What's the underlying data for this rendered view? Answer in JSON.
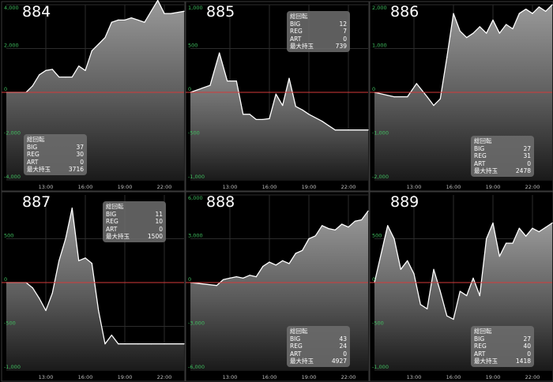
{
  "chart_data": [
    {
      "type": "area",
      "title": "884",
      "ylim": [
        -4000,
        4000
      ],
      "yticks": [
        4000,
        2000,
        0,
        -2000,
        -4000
      ],
      "yticklabels": [
        "4,000",
        "2,000",
        "0",
        "-2,000",
        "-4,000"
      ],
      "xticks": [
        13,
        16,
        19,
        22
      ],
      "xticklabels": [
        "13:00",
        "16:00",
        "19:00",
        "22:00"
      ],
      "xlim": [
        10,
        23.5
      ],
      "x": [
        10,
        11.5,
        12,
        12.5,
        13,
        13.5,
        14,
        14.5,
        15,
        15.5,
        16,
        16.5,
        17,
        17.5,
        18,
        18.5,
        19,
        19.5,
        20,
        20.5,
        21,
        21.5,
        22,
        22.5,
        23.5
      ],
      "y": [
        0,
        0,
        300,
        800,
        1000,
        1050,
        700,
        700,
        700,
        1200,
        1000,
        1900,
        2200,
        2500,
        3200,
        3300,
        3300,
        3400,
        3300,
        3200,
        3700,
        4200,
        3600,
        3600,
        3700
      ],
      "stats": {
        "header": "総回転",
        "rows": [
          [
            "BIG",
            "37"
          ],
          [
            "REG",
            "30"
          ],
          [
            "ART",
            "0"
          ],
          [
            "最大持玉",
            "3716"
          ]
        ]
      },
      "stats_pos": "bottom-left"
    },
    {
      "type": "area",
      "title": "885",
      "ylim": [
        -1000,
        1000
      ],
      "yticks": [
        1000,
        500,
        0,
        -500,
        -1000
      ],
      "yticklabels": [
        "1,000",
        "500",
        "0",
        "-500",
        "-1,000"
      ],
      "xticks": [
        13,
        16,
        19,
        22
      ],
      "xticklabels": [
        "13:00",
        "16:00",
        "19:00",
        "22:00"
      ],
      "xlim": [
        10,
        23.5
      ],
      "x": [
        10,
        11.5,
        12.2,
        12.8,
        13.5,
        14,
        14.5,
        15,
        15.5,
        16,
        16.5,
        17,
        17.5,
        18,
        18.5,
        19,
        20,
        20.5,
        21,
        22,
        23.5
      ],
      "y": [
        0,
        80,
        450,
        130,
        130,
        -250,
        -250,
        -310,
        -310,
        -300,
        -20,
        -150,
        160,
        -160,
        -200,
        -250,
        -330,
        -380,
        -430,
        -430,
        -430
      ],
      "stats": {
        "header": "総回転",
        "rows": [
          [
            "BIG",
            "12"
          ],
          [
            "REG",
            "7"
          ],
          [
            "ART",
            "0"
          ],
          [
            "最大持玉",
            "739"
          ]
        ]
      },
      "stats_pos": "top-right"
    },
    {
      "type": "area",
      "title": "886",
      "ylim": [
        -2000,
        2000
      ],
      "yticks": [
        2000,
        1000,
        0,
        -1000,
        -2000
      ],
      "yticklabels": [
        "2,000",
        "1,000",
        "0",
        "-1,000",
        "-2,000"
      ],
      "xticks": [
        13,
        16,
        19,
        22
      ],
      "xticklabels": [
        "13:00",
        "16:00",
        "19:00",
        "22:00"
      ],
      "xlim": [
        10,
        23.5
      ],
      "x": [
        10,
        11.5,
        12.5,
        13.2,
        14,
        14.5,
        15,
        15.5,
        16,
        16.5,
        17,
        17.5,
        18,
        18.5,
        19,
        19.5,
        20,
        20.5,
        21,
        21.5,
        22,
        22.5,
        23,
        23.5
      ],
      "y": [
        0,
        -100,
        -100,
        200,
        -100,
        -300,
        -150,
        800,
        1800,
        1400,
        1250,
        1350,
        1500,
        1350,
        1650,
        1350,
        1550,
        1450,
        1800,
        1900,
        1800,
        1950,
        1850,
        2000
      ],
      "stats": {
        "header": "総回転",
        "rows": [
          [
            "BIG",
            "27"
          ],
          [
            "REG",
            "31"
          ],
          [
            "ART",
            "0"
          ],
          [
            "最大持玉",
            "2478"
          ]
        ]
      },
      "stats_pos": "bottom-right"
    },
    {
      "type": "area",
      "title": "887",
      "ylim": [
        -1000,
        1000
      ],
      "yticks": [
        500,
        0,
        -500,
        -1000
      ],
      "yticklabels": [
        "500",
        "0",
        "-500",
        "-1,000"
      ],
      "xticks": [
        13,
        16,
        19,
        22
      ],
      "xticklabels": [
        "13:00",
        "16:00",
        "19:00",
        "22:00"
      ],
      "xlim": [
        10,
        23.5
      ],
      "x": [
        10,
        11.5,
        12,
        12.5,
        13,
        13.5,
        14,
        14.5,
        15,
        15.5,
        16,
        16.5,
        17,
        17.5,
        18,
        18.5,
        19,
        20,
        21,
        22,
        23.5
      ],
      "y": [
        0,
        0,
        -60,
        -180,
        -320,
        -120,
        250,
        500,
        850,
        250,
        280,
        220,
        -320,
        -700,
        -600,
        -700,
        -700,
        -700,
        -700,
        -700,
        -700
      ],
      "stats": {
        "header": "総回転",
        "rows": [
          [
            "BIG",
            "11"
          ],
          [
            "REG",
            "10"
          ],
          [
            "ART",
            "0"
          ],
          [
            "最大持玉",
            "1500"
          ]
        ]
      },
      "stats_pos": "top-right"
    },
    {
      "type": "area",
      "title": "888",
      "ylim": [
        -6000,
        6000
      ],
      "yticks": [
        6000,
        3000,
        0,
        -3000,
        -6000
      ],
      "yticklabels": [
        "6,000",
        "3,000",
        "0",
        "-3,000",
        "-6,000"
      ],
      "xticks": [
        13,
        16,
        19,
        22
      ],
      "xticklabels": [
        "13:00",
        "16:00",
        "19:00",
        "22:00"
      ],
      "xlim": [
        10,
        23.5
      ],
      "x": [
        10,
        12,
        12.5,
        13,
        13.5,
        14,
        14.5,
        15,
        15.5,
        16,
        16.5,
        17,
        17.5,
        18,
        18.5,
        19,
        19.5,
        20,
        20.5,
        21,
        21.5,
        22,
        22.5,
        23,
        23.5
      ],
      "y": [
        0,
        -200,
        200,
        300,
        400,
        300,
        500,
        400,
        1100,
        1400,
        1200,
        1500,
        1300,
        2000,
        2200,
        3000,
        3200,
        3900,
        3700,
        3600,
        4000,
        3800,
        4200,
        4300,
        4900
      ],
      "stats": {
        "header": "総回転",
        "rows": [
          [
            "BIG",
            "43"
          ],
          [
            "REG",
            "24"
          ],
          [
            "ART",
            "0"
          ],
          [
            "最大持玉",
            "4927"
          ]
        ]
      },
      "stats_pos": "bottom-right"
    },
    {
      "type": "area",
      "title": "889",
      "ylim": [
        -1000,
        1000
      ],
      "yticks": [
        500,
        0,
        -500,
        -1000
      ],
      "yticklabels": [
        "500",
        "0",
        "-500",
        "-1,000"
      ],
      "xticks": [
        13,
        16,
        19,
        22
      ],
      "xticklabels": [
        "13:00",
        "16:00",
        "19:00",
        "22:00"
      ],
      "xlim": [
        10,
        23.5
      ],
      "x": [
        10,
        11,
        11.5,
        12,
        12.5,
        13,
        13.5,
        14,
        14.5,
        15,
        15.5,
        16,
        16.5,
        17,
        17.5,
        18,
        18.5,
        19,
        19.5,
        20,
        20.5,
        21,
        21.5,
        22,
        22.5,
        23,
        23.5
      ],
      "y": [
        0,
        650,
        500,
        150,
        250,
        100,
        -250,
        -300,
        150,
        -100,
        -380,
        -420,
        -100,
        -150,
        50,
        -150,
        500,
        680,
        300,
        450,
        450,
        620,
        530,
        620,
        580,
        630,
        680
      ],
      "stats": {
        "header": "総回転",
        "rows": [
          [
            "BIG",
            "27"
          ],
          [
            "REG",
            "40"
          ],
          [
            "ART",
            "0"
          ],
          [
            "最大持玉",
            "1418"
          ]
        ]
      },
      "stats_pos": "bottom-right"
    }
  ]
}
